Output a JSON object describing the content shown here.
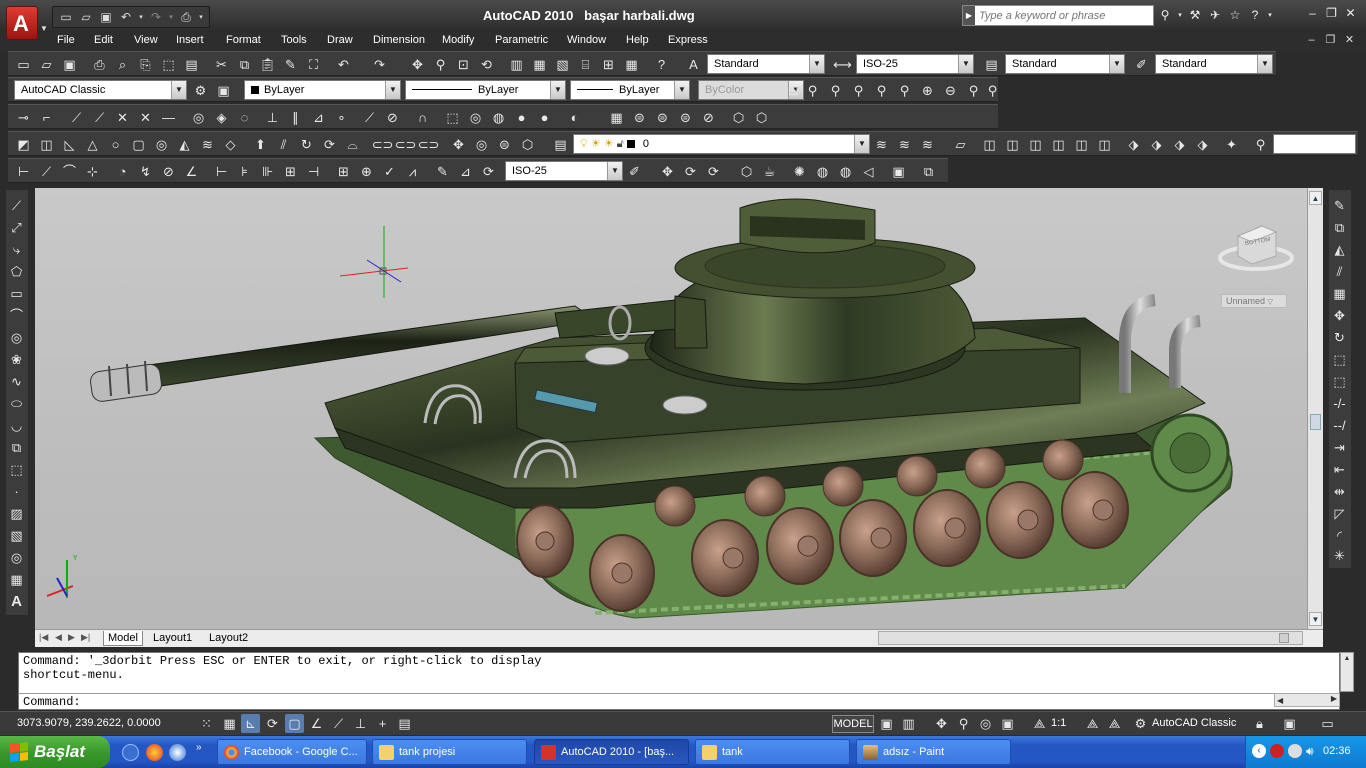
{
  "window": {
    "title": "AutoCAD 2010",
    "document": "başar harbali.dwg",
    "search_placeholder": "Type a keyword or phrase"
  },
  "menu": [
    "File",
    "Edit",
    "View",
    "Insert",
    "Format",
    "Tools",
    "Draw",
    "Dimension",
    "Modify",
    "Parametric",
    "Window",
    "Help",
    "Express"
  ],
  "styles": {
    "text_style": "Standard",
    "dim_style": "ISO-25",
    "table_style": "Standard",
    "mleader_style": "Standard"
  },
  "workspace": {
    "name": "AutoCAD Classic",
    "layer_color": "ByLayer",
    "linetype": "ByLayer",
    "lineweight": "ByLayer",
    "plot_style": "ByColor",
    "current_layer": "0",
    "dim_combo": "ISO-25"
  },
  "viewcube": {
    "face": "BOTTOM",
    "ucs_name": "Unnamed"
  },
  "layouts": {
    "tabs": [
      "Model",
      "Layout1",
      "Layout2"
    ],
    "active": "Model"
  },
  "command": {
    "history_line1": "Command: '_3dorbit Press ESC or ENTER to exit, or right-click to display",
    "history_line2": "shortcut-menu.",
    "prompt": "Command:"
  },
  "status": {
    "coordinates": "3073.9079, 239.2622, 0.0000",
    "model_label": "MODEL",
    "annotation_scale": "1:1",
    "workspace_label": "AutoCAD Classic"
  },
  "taskbar": {
    "start": "Başlat",
    "buttons": [
      "Facebook - Google C...",
      "tank projesi",
      "AutoCAD 2010 - [baş...",
      "tank",
      "adsız - Paint"
    ],
    "active_index": 2,
    "clock": "02:36"
  },
  "colors": {
    "title_bg": "#2c2c2c",
    "viewport_bg": "#c4c4c4",
    "tank_body": "#3f4a2c",
    "track": "#5f8a4a",
    "wheel": "#8a6a58",
    "taskbar": "#2456c4",
    "start": "#3a9a2c"
  }
}
